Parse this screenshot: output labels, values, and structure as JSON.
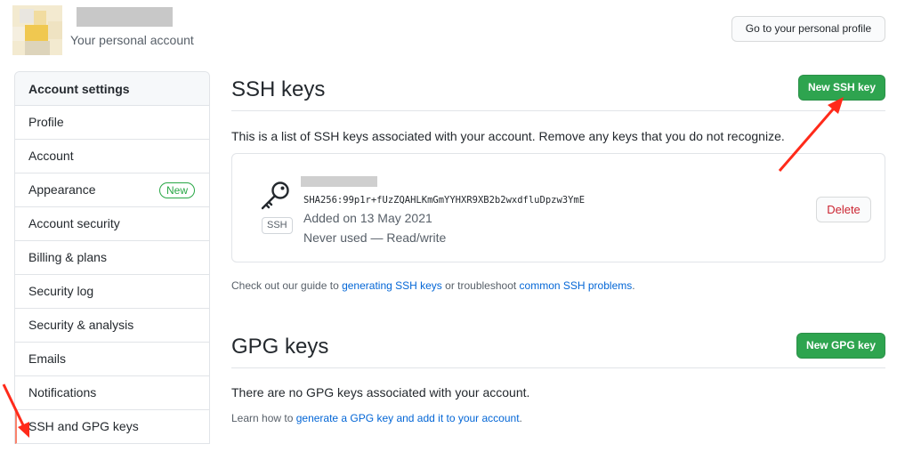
{
  "header": {
    "account_subtitle": "Your personal account",
    "profile_button": "Go to your personal profile"
  },
  "sidebar": {
    "heading": "Account settings",
    "items": [
      {
        "label": "Profile"
      },
      {
        "label": "Account"
      },
      {
        "label": "Appearance",
        "badge": "New"
      },
      {
        "label": "Account security"
      },
      {
        "label": "Billing & plans"
      },
      {
        "label": "Security log"
      },
      {
        "label": "Security & analysis"
      },
      {
        "label": "Emails"
      },
      {
        "label": "Notifications"
      },
      {
        "label": "SSH and GPG keys",
        "selected": true
      }
    ]
  },
  "ssh": {
    "title": "SSH keys",
    "new_button": "New SSH key",
    "description": "This is a list of SSH keys associated with your account. Remove any keys that you do not recognize.",
    "key": {
      "tag": "SSH",
      "fingerprint": "SHA256:99p1r+fUzZQAHLKmGmYYHXR9XB2b2wxdfluDpzw3YmE",
      "added": "Added on 13 May 2021",
      "usage": "Never used — Read/write",
      "delete_button": "Delete"
    },
    "guide": {
      "prefix": "Check out our guide to ",
      "link1": "generating SSH keys",
      "middle": " or troubleshoot ",
      "link2": "common SSH problems",
      "suffix": "."
    }
  },
  "gpg": {
    "title": "GPG keys",
    "new_button": "New GPG key",
    "empty_text": "There are no GPG keys associated with your account.",
    "learn": {
      "prefix": "Learn how to ",
      "link": "generate a GPG key and add it to your account",
      "suffix": "."
    }
  },
  "colors": {
    "primary_green": "#2ea44f",
    "link_blue": "#0366d6",
    "danger_red": "#cb2431",
    "selected_marker": "#f9826c",
    "annotation_arrow": "#ff2a1a"
  }
}
